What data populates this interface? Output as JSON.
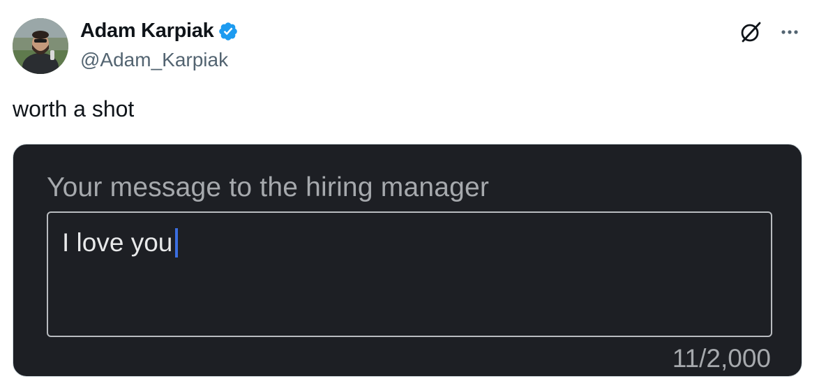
{
  "author": {
    "display_name": "Adam Karpiak",
    "handle": "@Adam_Karpiak",
    "verified": true,
    "verified_icon": "verified-badge-icon",
    "avatar": "profile-photo"
  },
  "actions": {
    "grok_icon": "grok-icon",
    "more_icon": "more-options-icon"
  },
  "tweet": {
    "text": "worth a shot"
  },
  "media": {
    "field_label": "Your message to the hiring manager",
    "message_value": "I love you",
    "char_count": "11/2,000"
  },
  "colors": {
    "verified_blue": "#1d9bf0",
    "media_background": "#1d1f24",
    "caret": "#3b6ee0"
  }
}
